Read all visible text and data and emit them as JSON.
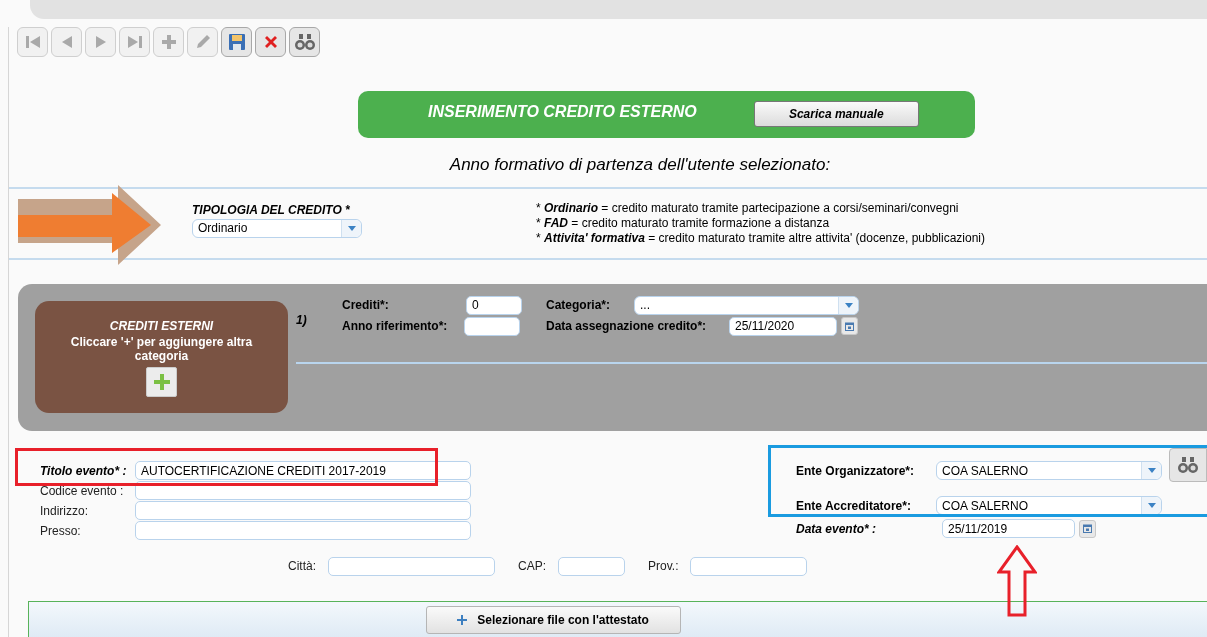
{
  "toolbar": [
    {
      "kind": "first",
      "disabled": true
    },
    {
      "kind": "prev",
      "disabled": true
    },
    {
      "kind": "next",
      "disabled": true
    },
    {
      "kind": "last",
      "disabled": true
    },
    {
      "kind": "add",
      "disabled": true
    },
    {
      "kind": "edit",
      "disabled": true
    },
    {
      "kind": "save",
      "disabled": false
    },
    {
      "kind": "delete",
      "disabled": false
    },
    {
      "kind": "search",
      "disabled": false
    }
  ],
  "header": {
    "title": "INSERIMENTO CREDITO ESTERNO",
    "button": "Scarica manuale"
  },
  "subtitle": "Anno formativo di partenza dell'utente selezionato:",
  "tipologia": {
    "label": "TIPOLOGIA DEL CREDITO *",
    "value": "Ordinario",
    "notes": [
      "* **Ordinario** = credito maturato tramite partecipazione a corsi/seminari/convegni",
      "* **FAD** = credito maturato tramite formazione a distanza",
      "* **Attivita' formativa** = credito maturato tramite altre attivita' (docenze, pubblicazioni)"
    ]
  },
  "crediti_panel": {
    "title": "CREDITI ESTERNI",
    "text": "Cliccare '+' per aggiungere altra categoria",
    "index": "1)",
    "crediti": {
      "label": "Crediti*:",
      "value": "0"
    },
    "anno": {
      "label": "Anno riferimento*:"
    },
    "categoria": {
      "label": "Categoria*:",
      "value": "..."
    },
    "data_assegnazione": {
      "label": "Data assegnazione credito*:",
      "value": "25/11/2020"
    }
  },
  "evento": {
    "fields": [
      {
        "label": "Titolo evento* :",
        "value": "AUTOCERTIFICAZIONE CREDITI 2017-2019",
        "required": true
      },
      {
        "label": "Codice evento :",
        "required": false
      },
      {
        "label": "Indirizzo:",
        "required": false
      },
      {
        "label": "Presso:",
        "required": false
      }
    ],
    "address": [
      {
        "label": "Città:"
      },
      {
        "label": "CAP:"
      },
      {
        "label": "Prov.:"
      }
    ],
    "ente_organizzatore": {
      "label": "Ente Organizzatore*:",
      "value": "COA SALERNO"
    },
    "ente_accreditatore": {
      "label": "Ente Accreditatore*:",
      "value": "COA SALERNO"
    },
    "data_evento": {
      "label": "Data evento* :",
      "value": "25/11/2019"
    }
  },
  "upload_button": "Selezionare file con l'attestato"
}
